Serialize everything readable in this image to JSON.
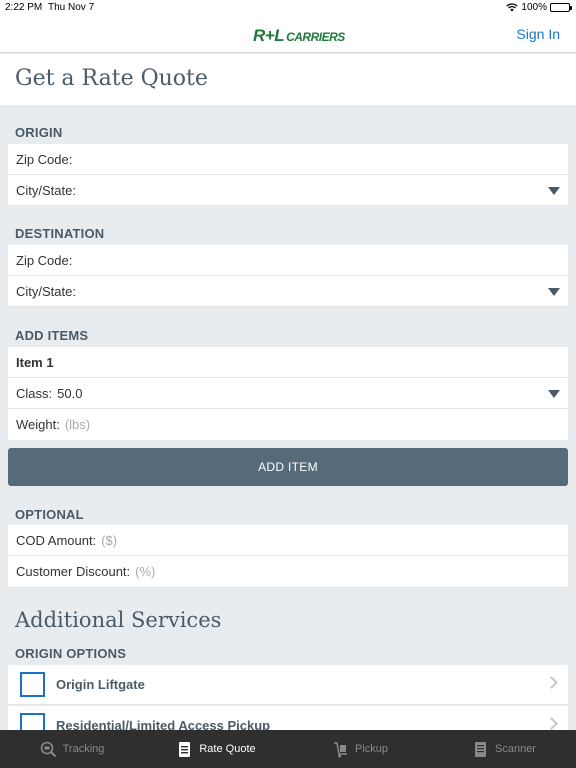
{
  "status_bar": {
    "time": "2:22 PM",
    "date": "Thu Nov 7",
    "battery": "100%"
  },
  "header": {
    "logo_mark": "R+L",
    "logo_text": "CARRIERS",
    "signin_label": "Sign In"
  },
  "page": {
    "title": "Get a Rate Quote"
  },
  "origin": {
    "heading": "ORIGIN",
    "zip_label": "Zip Code:",
    "city_label": "City/State:"
  },
  "destination": {
    "heading": "DESTINATION",
    "zip_label": "Zip Code:",
    "city_label": "City/State:"
  },
  "items": {
    "heading": "ADD ITEMS",
    "item_title": "Item 1",
    "class_label": "Class:",
    "class_value": "50.0",
    "weight_label": "Weight:",
    "weight_placeholder": "(lbs)",
    "add_button": "ADD ITEM"
  },
  "optional": {
    "heading": "OPTIONAL",
    "cod_label": "COD Amount:",
    "cod_placeholder": "($)",
    "discount_label": "Customer Discount:",
    "discount_placeholder": "(%)"
  },
  "additional": {
    "heading": "Additional Services",
    "origin_options_heading": "ORIGIN OPTIONS",
    "options": [
      "Origin Liftgate",
      "Residential/Limited Access Pickup"
    ]
  },
  "tabs": [
    {
      "label": "Tracking",
      "icon": "tracking-search-icon",
      "active": false
    },
    {
      "label": "Rate Quote",
      "icon": "document-icon",
      "active": true
    },
    {
      "label": "Pickup",
      "icon": "hand-truck-icon",
      "active": false
    },
    {
      "label": "Scanner",
      "icon": "scanner-icon",
      "active": false
    }
  ],
  "colors": {
    "accent": "#1a73c9",
    "section_text": "#4a5a66",
    "button": "#566b7a",
    "tabbar": "#2f2f2f",
    "brand": "#1f7a3a"
  }
}
